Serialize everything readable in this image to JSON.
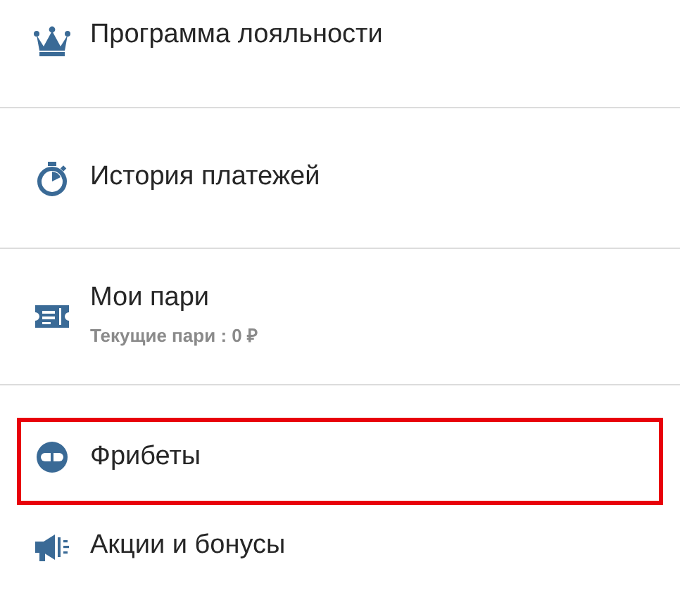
{
  "menu_items": [
    {
      "label": "Программа лояльности",
      "highlighted": false
    },
    {
      "label": "История платежей",
      "highlighted": false
    },
    {
      "label": "Мои пари",
      "subtitle": "Текущие пари : 0 ₽",
      "highlighted": false
    },
    {
      "label": "Фрибеты",
      "highlighted": true
    },
    {
      "label": "Акции и бонусы",
      "highlighted": false
    }
  ]
}
